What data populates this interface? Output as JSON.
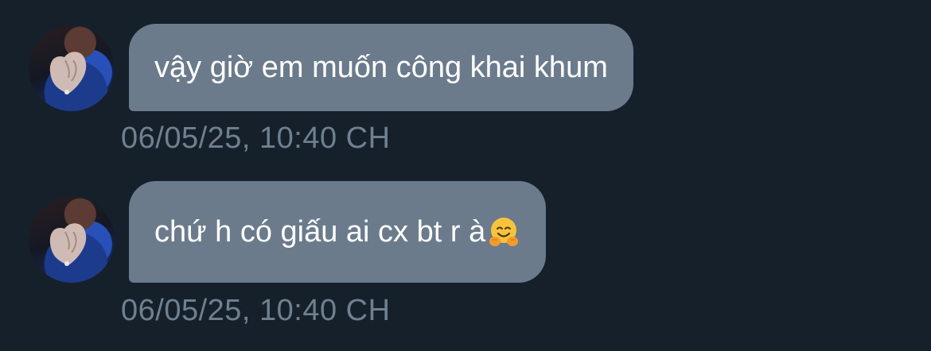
{
  "conversation": {
    "messages": [
      {
        "text": "vậy giờ em muốn công khai khum",
        "timestamp": "06/05/25, 10:40 CH"
      },
      {
        "text": "chứ h có giấu ai cx bt r à",
        "emoji": "hugging-face",
        "timestamp": "06/05/25, 10:40 CH"
      }
    ]
  },
  "colors": {
    "background": "#16202b",
    "bubble": "#6b7b8c",
    "timestamp": "#6f8090"
  }
}
